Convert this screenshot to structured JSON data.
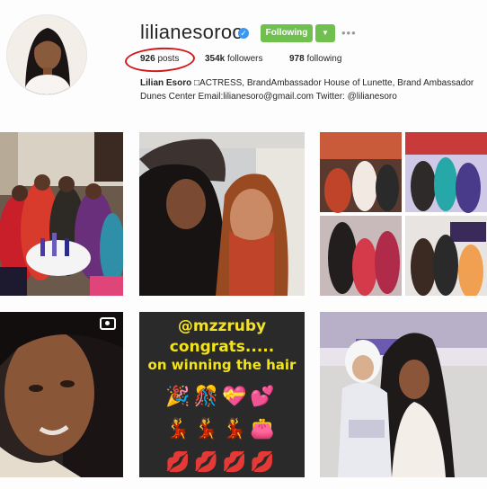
{
  "profile": {
    "username": "lilianesoroo",
    "verified_badge_icon": "verified-check-icon",
    "follow_button_label": "Following",
    "dropdown_icon": "caret-down-icon",
    "more_icon": "ellipsis-icon",
    "more_label": "•••"
  },
  "stats": {
    "posts_count": "926",
    "posts_label": "posts",
    "followers_count": "354k",
    "followers_label": "followers",
    "following_count": "978",
    "following_label": "following"
  },
  "bio": {
    "name": "Lilian Esoro",
    "text": " □ACTRESS, BrandAmbassador House of Lunette, Brand Ambassador Dunes Center Email:lilianesoro@gmail.com Twitter: @lilianesoro"
  },
  "grid": {
    "post5_caption_line1": "@mzzruby",
    "post5_caption_line2": "congrats.....",
    "post5_caption_line3": "on winning the hair",
    "post5_emoji_row1": "🎉🎊💝💕",
    "post5_emoji_row2": "💃💃💃👛",
    "post5_emoji_row3": "💋💋💋💋",
    "video_icon": "video-camera-icon"
  },
  "colors": {
    "follow_green": "#70c050",
    "verified_blue": "#3897f0",
    "annotation_red": "#d11a1a",
    "caption_yellow": "#f2e31a"
  }
}
